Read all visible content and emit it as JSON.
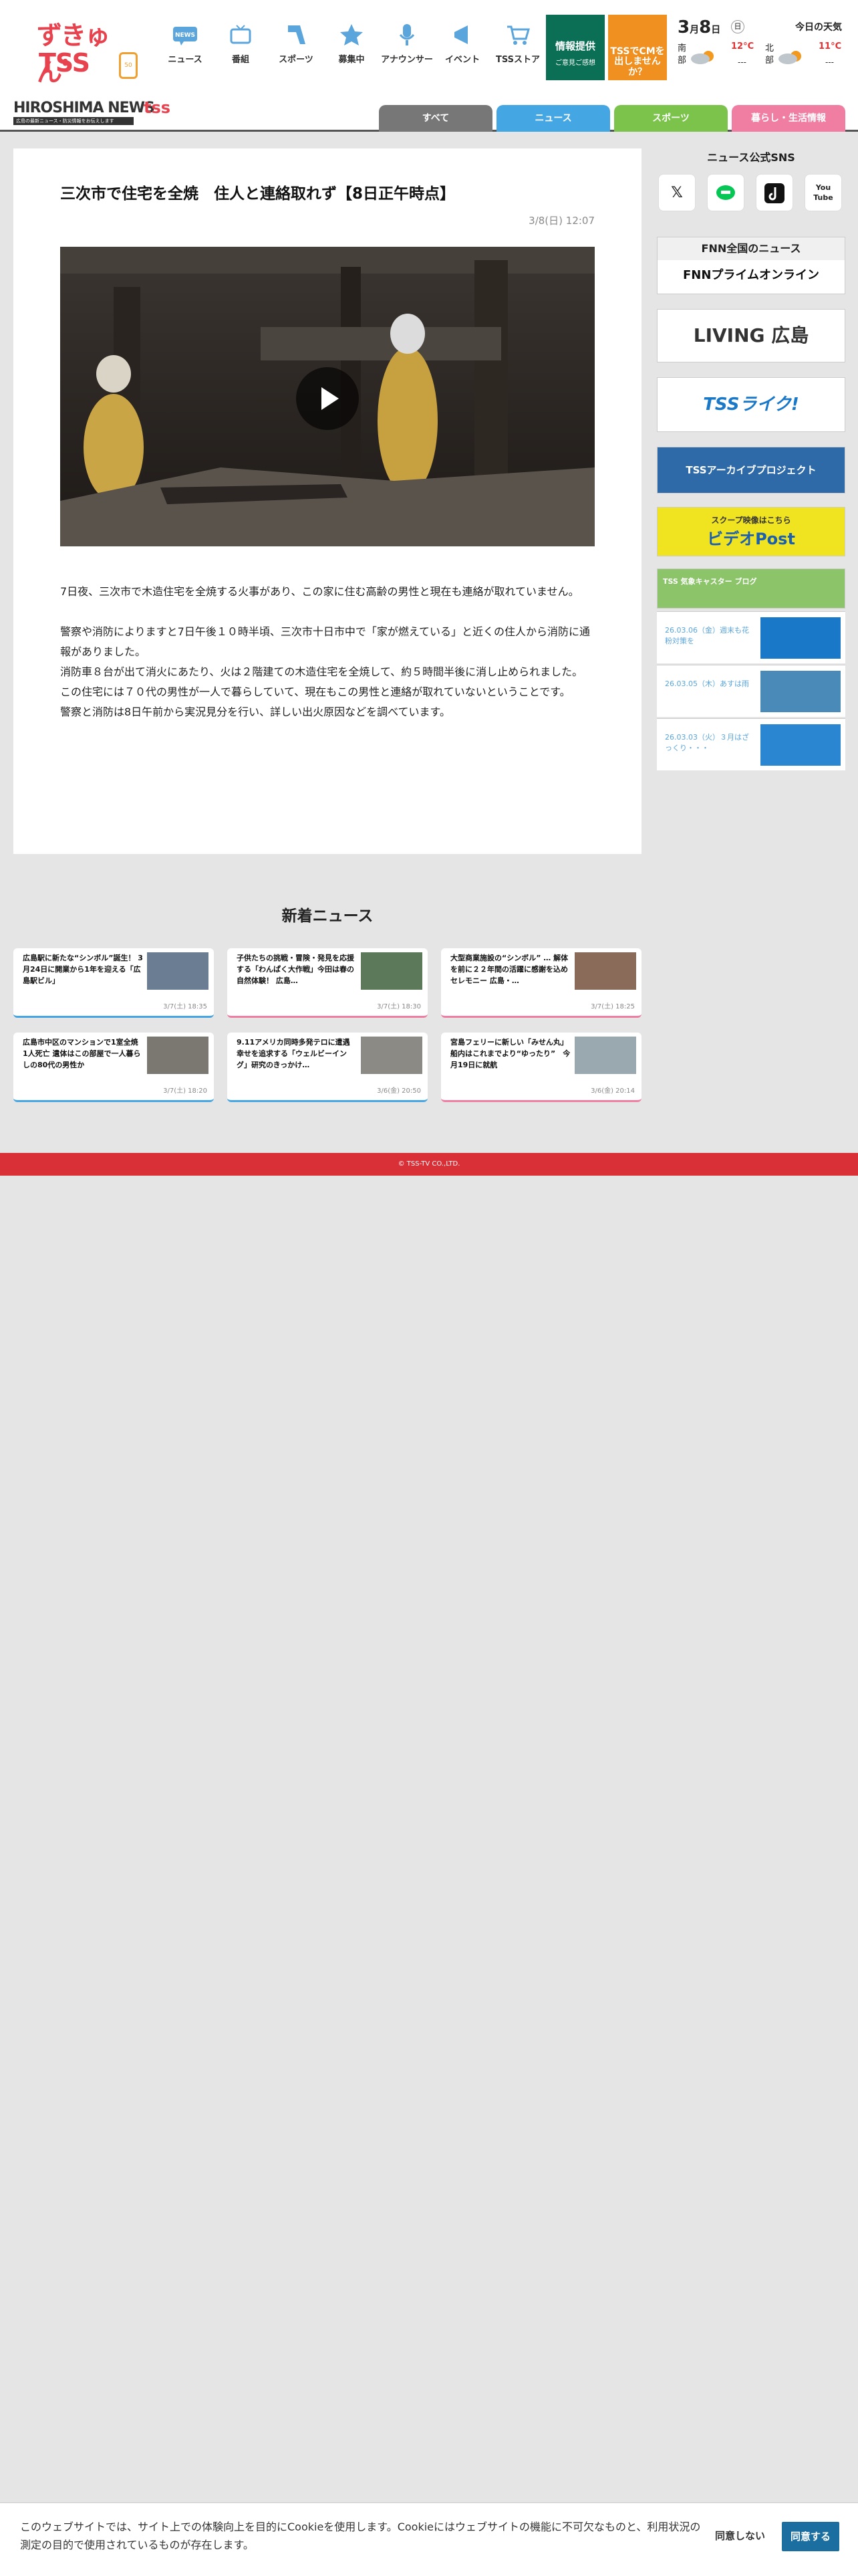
{
  "header": {
    "logo_top": "ずきゅんﾟ",
    "logo_bottom": "TSS",
    "logo_anniv": "50",
    "nav": [
      {
        "label": "ニュース",
        "icon": "news-icon"
      },
      {
        "label": "番組",
        "icon": "tv-icon"
      },
      {
        "label": "スポーツ",
        "icon": "sports-icon"
      },
      {
        "label": "募集中",
        "icon": "star-icon"
      },
      {
        "label": "アナウンサー",
        "icon": "microphone-icon"
      },
      {
        "label": "イベント",
        "icon": "megaphone-icon"
      },
      {
        "label": "TSSストア",
        "icon": "cart-icon"
      }
    ],
    "info_button": {
      "title": "情報提供",
      "sub": "ご意見ご感想"
    },
    "cm_button": "TSSでCMを出しませんか？",
    "weather": {
      "month": "3",
      "day": "8",
      "weekday": "日",
      "title": "今日の天気",
      "south_label": "南部",
      "south_temp": "12°C",
      "south_sub": "---",
      "north_label": "北部",
      "north_temp": "11°C",
      "north_sub": "---"
    }
  },
  "subbar": {
    "logo_main": "HIROSHIMA NEWS",
    "logo_brand": "tss",
    "logo_tag": "広島の最新ニュース・防災情報をお伝えします",
    "tabs": [
      {
        "label": "すべて",
        "color": "#777777"
      },
      {
        "label": "ニュース",
        "color": "#45a6e4"
      },
      {
        "label": "スポーツ",
        "color": "#7bc34a"
      },
      {
        "label": "暮らし・生活情報",
        "color": "#f07ea3"
      }
    ]
  },
  "article": {
    "title": "三次市で住宅を全焼　住人と連絡取れず【8日正午時点】",
    "date": "3/8(日) 12:07",
    "paragraphs": [
      "7日夜、三次市で木造住宅を全焼する火事があり、この家に住む高齢の男性と現在も連絡が取れていません。",
      "",
      "警察や消防によりますと7日午後１０時半頃、三次市十日市中で「家が燃えている」と近くの住人から消防に通報がありました。",
      "消防車８台が出て消火にあたり、火は２階建ての木造住宅を全焼して、約５時間半後に消し止められました。",
      "この住宅には７０代の男性が一人で暮らしていて、現在もこの男性と連絡が取れていないということです。",
      "警察と消防は8日午前から実況見分を行い、詳しい出火原因などを調べています。"
    ]
  },
  "sidebar": {
    "sns_title": "ニュース公式SNS",
    "sns": [
      "X",
      "LINE",
      "TikTok",
      "YouTube"
    ],
    "fnn_title": "FNN全国のニュース",
    "fnn_logo": "FNNプライムオンライン",
    "living": "LIVING 広島",
    "live": "TSSライク!",
    "archive": "TSSアーカイブプロジェクト",
    "videopost_top": "スクープ映像はこちら",
    "videopost": "ビデオPost",
    "caster": "TSS 気象キャスター ブログ",
    "minis": [
      {
        "text": "26.03.06（金）週末も花粉対策を"
      },
      {
        "text": "26.03.05（木）あすは雨"
      },
      {
        "text": "26.03.03（火）３月はざっくり・・・"
      }
    ]
  },
  "latest": {
    "title": "新着ニュース",
    "items": [
      {
        "title": "広島駅に新たな“シンボル”誕生！ 3月24日に開業から1年を迎える「広島駅ビル」",
        "date": "3/7(土) 18:35",
        "accent": "#45a6e4"
      },
      {
        "title": "子供たちの挑戦・冒険・発見を応援する「わんぱく大作戦」今田は春の自然体験！ 広島…",
        "date": "3/7(土) 18:30",
        "accent": "#f07ea3"
      },
      {
        "title": "大型商業施設の“シンボル” … 解体を前に２２年間の活躍に感謝を込めセレモニー 広島・…",
        "date": "3/7(土) 18:25",
        "accent": "#f07ea3"
      },
      {
        "title": "広島市中区のマンションで1室全焼 1人死亡 遺体はこの部屋で一人暮らしの80代の男性か",
        "date": "3/7(土) 18:20",
        "accent": "#45a6e4"
      },
      {
        "title": "9.11アメリカ同時多発テロに遭遇　幸せを追求する「ウェルビーイング」研究のきっかけ…",
        "date": "3/6(金) 20:50",
        "accent": "#45a6e4"
      },
      {
        "title": "宮島フェリーに新しい「みせん丸」 船内はこれまでより“ゆったり”　今月19日に就航",
        "date": "3/6(金) 20:14",
        "accent": "#f07ea3"
      }
    ]
  },
  "footer": "© TSS-TV CO.,LTD.",
  "cookie": {
    "text": "このウェブサイトでは、サイト上での体験向上を目的にCookieを使用します。Cookieにはウェブサイトの機能に不可欠なものと、利用状況の測定の目的で使用されているものが存在します。",
    "decline": "同意しない",
    "agree": "同意する"
  }
}
